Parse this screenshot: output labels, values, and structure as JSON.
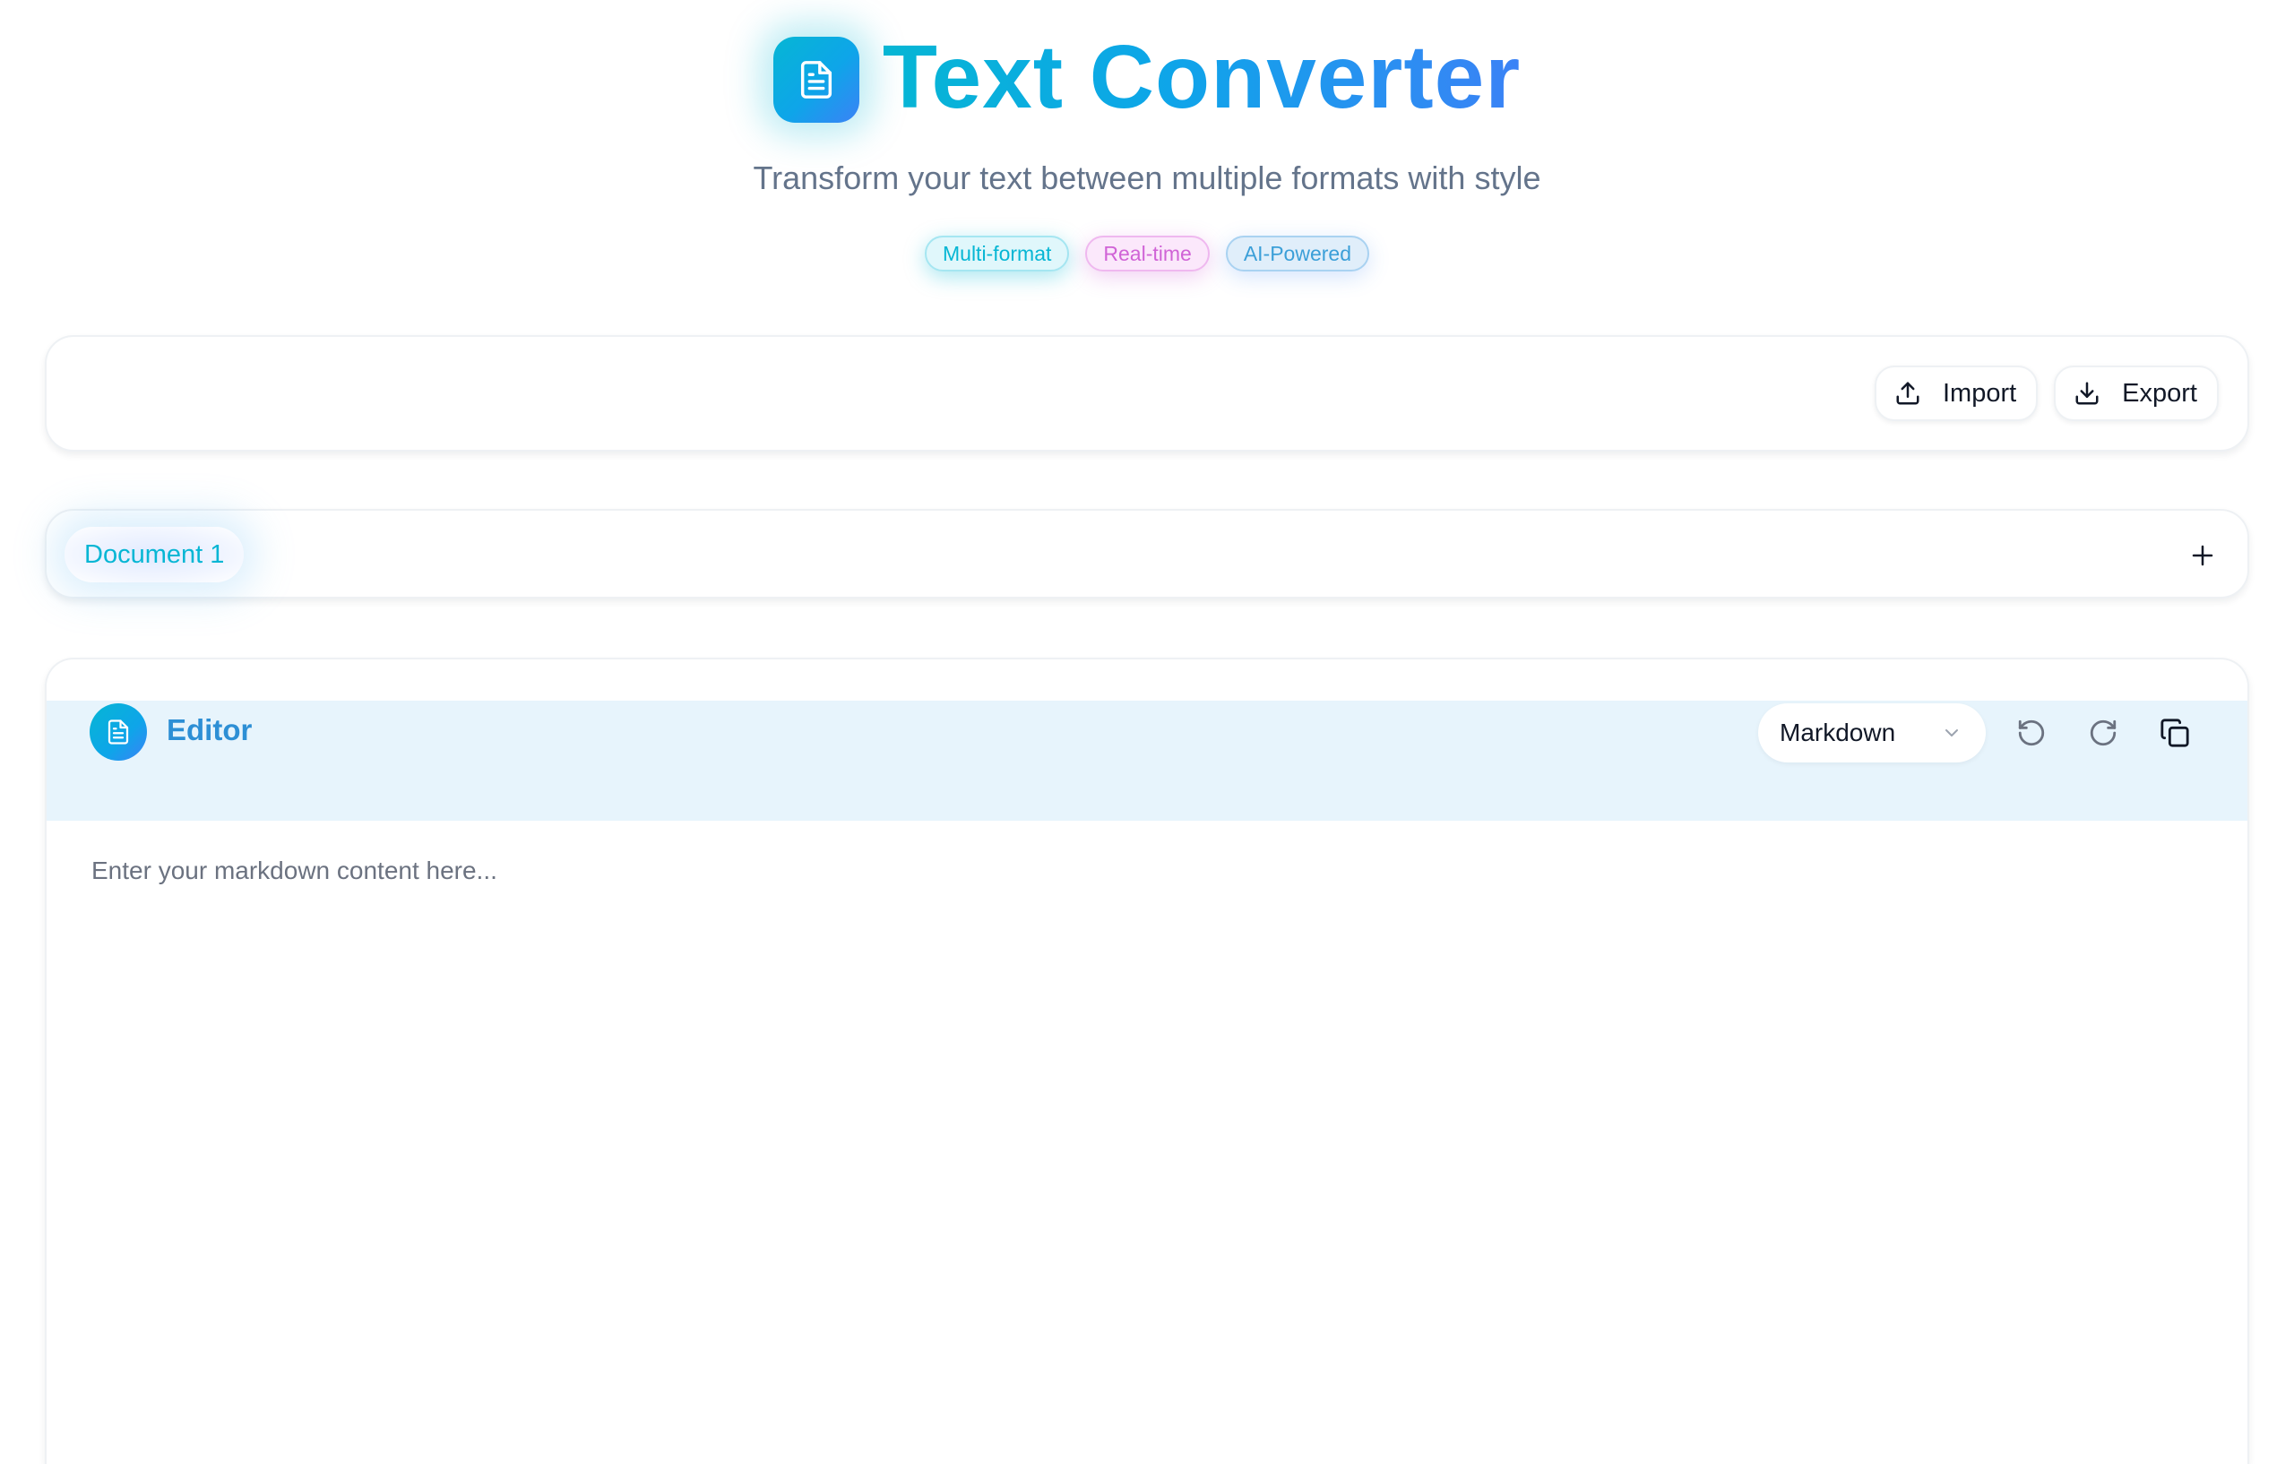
{
  "header": {
    "title": "Text Converter",
    "subtitle": "Transform your text between multiple formats with style",
    "logo_icon": "document-icon",
    "badges": [
      "Multi-format",
      "Real-time",
      "AI-Powered"
    ]
  },
  "toolbar": {
    "import_label": "Import",
    "import_icon": "upload-icon",
    "export_label": "Export",
    "export_icon": "download-icon"
  },
  "tabs": {
    "items": [
      "Document 1"
    ],
    "add_icon": "plus-icon"
  },
  "editor": {
    "title": "Editor",
    "icon": "document-icon",
    "format_selected": "Markdown",
    "placeholder": "Enter your markdown content here...",
    "actions": [
      "undo-icon",
      "redo-icon",
      "copy-icon"
    ]
  },
  "colors": {
    "accent_cyan": "#06b6d4",
    "accent_blue": "#3b82f6",
    "accent_pink": "#d063d6",
    "editor_header_bg": "#e7f4fc",
    "editor_title": "#2d8fd5"
  }
}
